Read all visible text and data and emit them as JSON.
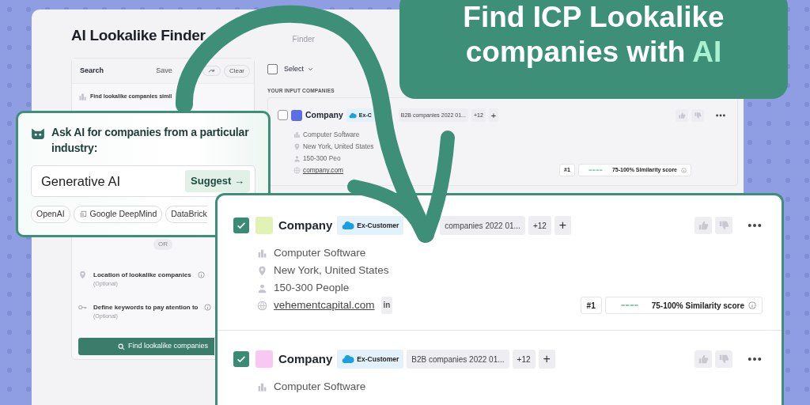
{
  "headline": {
    "text": "Find ICP Lookalike companies with",
    "accent": "AI"
  },
  "app": {
    "title": "AI Lookalike Finder",
    "breadcrumb": "Finder",
    "search_panel": {
      "title": "Search",
      "save": "Save",
      "clear": "Clear",
      "similar_label": "Find lookalike companies simil",
      "divider": "OR",
      "fields": [
        {
          "kind": "location",
          "label": "Location of lookalike companies",
          "hint": "(Optional)"
        },
        {
          "kind": "keywords",
          "label": "Define keywords to pay atention to",
          "hint": "(Optional)"
        }
      ],
      "submit": "Find lookalike companies"
    },
    "select": {
      "label": "Select",
      "checked": false
    },
    "section_label": "YOUR INPUT COMPANIES",
    "input_company": {
      "name": "Company",
      "selected": false,
      "color": "#5b6ee8",
      "tags": [
        {
          "kind": "crm",
          "label": "Ex-C"
        },
        {
          "kind": "list",
          "label": "B2B companies 2022 01..."
        }
      ],
      "count": "+12",
      "add": "+",
      "details": [
        {
          "kind": "industry",
          "text": "Computer Software"
        },
        {
          "kind": "location",
          "text": "New York, United States"
        },
        {
          "kind": "size",
          "text": "150-300 Peo"
        },
        {
          "kind": "website",
          "text": "company.com"
        }
      ],
      "rank": "#1",
      "score": "75-100% Similarity score"
    }
  },
  "ai_panel": {
    "prompt": "Ask AI for companies from a particular industry:",
    "value": "Generative AI",
    "button": "Suggest →",
    "chips": [
      {
        "label": "OpenAI",
        "kind": "plain"
      },
      {
        "label": "Google DeepMind",
        "kind": "icon"
      },
      {
        "label": "DataBrick",
        "kind": "plain"
      }
    ]
  },
  "results": [
    {
      "name": "Company",
      "selected": true,
      "color": "#e2f2b4",
      "tags": [
        {
          "kind": "crm",
          "label": "Ex-Customer"
        },
        {
          "kind": "list",
          "label": "companies 2022 01..."
        }
      ],
      "count": "+12",
      "add": "+",
      "details": [
        {
          "kind": "industry",
          "text": "Computer Software"
        },
        {
          "kind": "location",
          "text": "New York, United States"
        },
        {
          "kind": "size",
          "text": "150-300 People"
        },
        {
          "kind": "website",
          "text": "vehementcapital.com",
          "linkedin": "in"
        }
      ],
      "rank": "#1",
      "score": "75-100% Similarity score"
    },
    {
      "name": "Company",
      "selected": true,
      "color": "#f9c8f2",
      "tags": [
        {
          "kind": "crm",
          "label": "Ex-Customer"
        },
        {
          "kind": "list",
          "label": "B2B companies 2022 01..."
        }
      ],
      "count": "+12",
      "add": "+",
      "details": [
        {
          "kind": "industry",
          "text": "Computer Software"
        }
      ]
    }
  ]
}
